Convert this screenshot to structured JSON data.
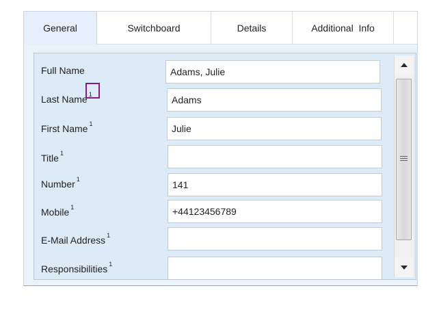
{
  "tabs": [
    {
      "label": "General",
      "active": true
    },
    {
      "label": "Switchboard"
    },
    {
      "label": "Details"
    },
    {
      "label": "Additional  Info"
    }
  ],
  "fields": [
    {
      "label": "Full Name",
      "sup": "",
      "value": "Adams, Julie"
    },
    {
      "label": "Last Name",
      "sup": "1",
      "value": "Adams"
    },
    {
      "label": "First Name",
      "sup": "1",
      "value": "Julie"
    },
    {
      "label": "Title",
      "sup": "1",
      "value": ""
    },
    {
      "label": "Number",
      "sup": "1",
      "value": "141"
    },
    {
      "label": "Mobile",
      "sup": "1",
      "value": "+44123456789"
    },
    {
      "label": "E-Mail Address",
      "sup": "1",
      "value": ""
    },
    {
      "label": "Responsibilities",
      "sup": "1",
      "value": ""
    }
  ],
  "colors": {
    "panel_bg": "#ddeaf8",
    "active_tab_bg": "#e4effa",
    "highlight_marker": "#8b1a7a"
  },
  "scrollbar_icons": {
    "up": "triangle-up-icon",
    "down": "triangle-down-icon",
    "grip": "grip-lines-icon"
  }
}
